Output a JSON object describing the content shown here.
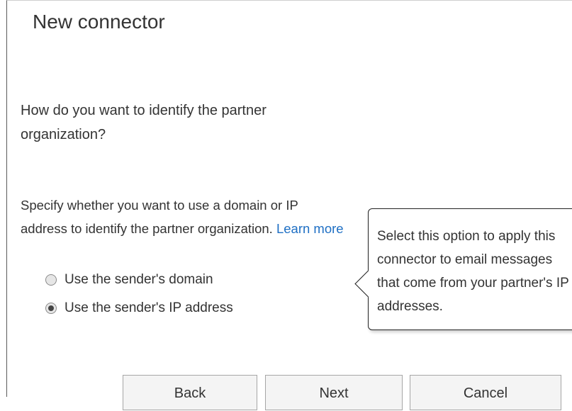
{
  "dialog": {
    "title": "New connector",
    "question": "How do you want to identify the partner organization?",
    "description": "Specify whether you want to use a domain or IP address to identify the partner organization.",
    "learn_more": "Learn more",
    "options": [
      {
        "label": "Use the sender's domain",
        "checked": false
      },
      {
        "label": "Use the sender's IP address",
        "checked": true
      }
    ],
    "callout": "Select this option to apply this connector to email messages that come from your partner's IP addresses.",
    "buttons": {
      "back": "Back",
      "next": "Next",
      "cancel": "Cancel"
    }
  }
}
